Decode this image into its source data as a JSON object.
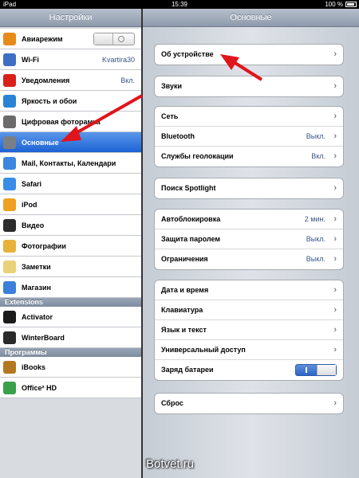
{
  "status": {
    "device": "iPad",
    "time": "15:39",
    "battery": "100 %"
  },
  "left": {
    "title": "Настройки",
    "items": [
      {
        "label": "Авиарежим",
        "value": "",
        "icon": "airplane-icon",
        "color": "#e88a1a"
      },
      {
        "label": "Wi-Fi",
        "value": "Kvartira30",
        "icon": "wifi-icon",
        "color": "#3e6fc4"
      },
      {
        "label": "Уведомления",
        "value": "Вкл.",
        "icon": "notifications-icon",
        "color": "#d9201a"
      },
      {
        "label": "Яркость и обои",
        "value": "",
        "icon": "brightness-icon",
        "color": "#2a84d6"
      },
      {
        "label": "Цифровая фоторамка",
        "value": "",
        "icon": "photo-frame-icon",
        "color": "#6b6b6b"
      },
      {
        "label": "Основные",
        "value": "",
        "icon": "gear-icon",
        "color": "#7a7f86"
      },
      {
        "label": "Mail, Контакты, Календари",
        "value": "",
        "icon": "mail-icon",
        "color": "#3c86e0"
      },
      {
        "label": "Safari",
        "value": "",
        "icon": "safari-icon",
        "color": "#3a8de6"
      },
      {
        "label": "iPod",
        "value": "",
        "icon": "ipod-icon",
        "color": "#f0a020"
      },
      {
        "label": "Видео",
        "value": "",
        "icon": "video-icon",
        "color": "#2b2b2b"
      },
      {
        "label": "Фотографии",
        "value": "",
        "icon": "photos-icon",
        "color": "#e8b23a"
      },
      {
        "label": "Заметки",
        "value": "",
        "icon": "notes-icon",
        "color": "#e8d27a"
      },
      {
        "label": "Магазин",
        "value": "",
        "icon": "store-icon",
        "color": "#3a7fd9"
      }
    ],
    "sections": {
      "extensions": "Extensions",
      "programs": "Программы"
    },
    "extensions": [
      {
        "label": "Activator",
        "icon": "activator-icon",
        "color": "#1b1b1b"
      },
      {
        "label": "WinterBoard",
        "icon": "winterboard-icon",
        "color": "#2a2a2a"
      }
    ],
    "programs": [
      {
        "label": "iBooks",
        "icon": "ibooks-icon",
        "color": "#b5771f"
      },
      {
        "label": "Office² HD",
        "icon": "office-icon",
        "color": "#3aa04a"
      }
    ]
  },
  "right": {
    "title": "Основные",
    "groups": [
      [
        {
          "label": "Об устройстве",
          "value": ""
        }
      ],
      [
        {
          "label": "Звуки",
          "value": ""
        }
      ],
      [
        {
          "label": "Сеть",
          "value": ""
        },
        {
          "label": "Bluetooth",
          "value": "Выкл."
        },
        {
          "label": "Службы геолокации",
          "value": "Вкл."
        }
      ],
      [
        {
          "label": "Поиск Spotlight",
          "value": ""
        }
      ],
      [
        {
          "label": "Автоблокировка",
          "value": "2 мин."
        },
        {
          "label": "Защита паролем",
          "value": "Выкл."
        },
        {
          "label": "Ограничения",
          "value": "Выкл."
        }
      ],
      [
        {
          "label": "Дата и время",
          "value": ""
        },
        {
          "label": "Клавиатура",
          "value": ""
        },
        {
          "label": "Язык и текст",
          "value": ""
        },
        {
          "label": "Универсальный доступ",
          "value": ""
        },
        {
          "label": "Заряд батареи",
          "value": ""
        }
      ],
      [
        {
          "label": "Сброс",
          "value": ""
        }
      ]
    ]
  },
  "watermark": "Botvet.ru",
  "colors": {
    "selected": "#2a6fdb",
    "arrow": "#e0141b",
    "value": "#385487"
  }
}
